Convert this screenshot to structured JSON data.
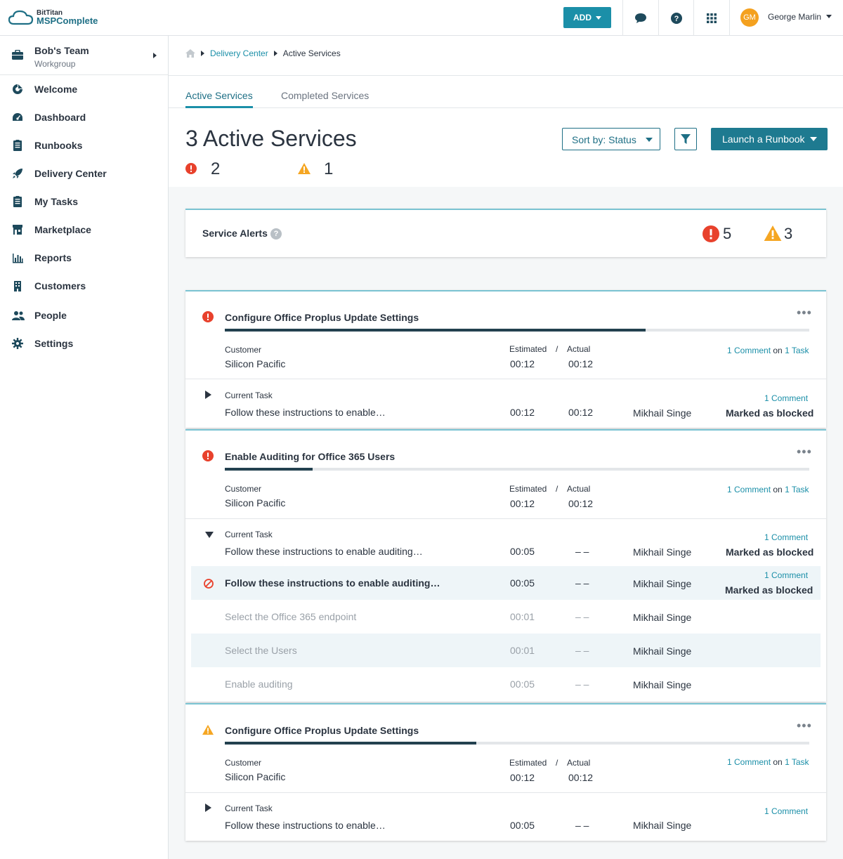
{
  "topbar": {
    "logo_small": "BitTitan",
    "logo_big": "MSPComplete",
    "add_label": "ADD",
    "user_initials": "GM",
    "user_name": "George Marlin"
  },
  "sidebar": {
    "team_name": "Bob's Team",
    "team_sub": "Workgroup",
    "items": [
      {
        "label": "Welcome",
        "icon": "welcome-icon"
      },
      {
        "label": "Dashboard",
        "icon": "dashboard-icon"
      },
      {
        "label": "Runbooks",
        "icon": "runbooks-icon"
      },
      {
        "label": "Delivery Center",
        "icon": "rocket-icon"
      },
      {
        "label": "My Tasks",
        "icon": "tasks-icon"
      },
      {
        "label": "Marketplace",
        "icon": "store-icon"
      },
      {
        "label": "Reports",
        "icon": "bar-chart-icon"
      },
      {
        "label": "Customers",
        "icon": "building-icon"
      },
      {
        "label": "People",
        "icon": "people-icon"
      },
      {
        "label": "Settings",
        "icon": "gear-icon"
      }
    ]
  },
  "breadcrumb": {
    "link": "Delivery Center",
    "current": "Active Services"
  },
  "tabs": {
    "active": "Active Services",
    "inactive": "Completed Services"
  },
  "page": {
    "title": "3 Active Services",
    "error_count": "2",
    "warning_count": "1",
    "sort_label": "Sort by: Status",
    "launch_label": "Launch a Runbook"
  },
  "alerts": {
    "title": "Service Alerts",
    "help": "?",
    "errors": "5",
    "warnings": "3"
  },
  "labels": {
    "customer": "Customer",
    "estimated": "Estimated",
    "slash": "/",
    "actual": "Actual",
    "current_task": "Current Task",
    "on": "on",
    "dots": "•••"
  },
  "services": [
    {
      "title": "Configure Office Proplus Update Settings",
      "status": "error",
      "progress": 0.72,
      "customer": "Silicon Pacific",
      "estimated": "00:12",
      "actual": "00:12",
      "comment_link": "1 Comment",
      "task_link": "1 Task",
      "task": {
        "name": "Follow these instructions to enable…",
        "estimated": "00:12",
        "actual": "00:12",
        "assignee": "Mikhail Singe",
        "comment_link": "1 Comment",
        "status": "Marked as blocked"
      }
    },
    {
      "title": "Enable Auditing for Office 365 Users",
      "status": "error",
      "progress": 0.15,
      "customer": "Silicon Pacific",
      "estimated": "00:12",
      "actual": "00:12",
      "comment_link": "1 Comment",
      "task_link": "1 Task",
      "task": {
        "name": "Follow these instructions to enable auditing…",
        "estimated": "00:05",
        "actual": "– –",
        "assignee": "Mikhail Singe",
        "comment_link": "1 Comment",
        "status": "Marked as blocked"
      },
      "subtasks": [
        {
          "name": "Follow these instructions to enable auditing…",
          "estimated": "00:05",
          "actual": "– –",
          "assignee": "Mikhail Singe",
          "comment_link": "1 Comment",
          "status": "Marked as blocked"
        },
        {
          "name": "Select the Office 365 endpoint",
          "estimated": "00:01",
          "actual": "– –",
          "assignee": "Mikhail Singe"
        },
        {
          "name": "Select the Users",
          "estimated": "00:01",
          "actual": "– –",
          "assignee": "Mikhail Singe"
        },
        {
          "name": "Enable auditing",
          "estimated": "00:05",
          "actual": "– –",
          "assignee": "Mikhail Singe"
        }
      ]
    },
    {
      "title": "Configure Office Proplus Update Settings",
      "status": "warning",
      "progress": 0.43,
      "customer": "Silicon Pacific",
      "estimated": "00:12",
      "actual": "00:12",
      "comment_link": "1 Comment",
      "task_link": "1 Task",
      "task": {
        "name": "Follow these instructions to enable…",
        "estimated": "00:05",
        "actual": "– –",
        "assignee": "Mikhail Singe",
        "comment_link": "1 Comment"
      }
    }
  ],
  "colors": {
    "accent": "#1b8fa8",
    "error": "#e8412c",
    "warning": "#f5a623",
    "progress": "#23414f"
  }
}
